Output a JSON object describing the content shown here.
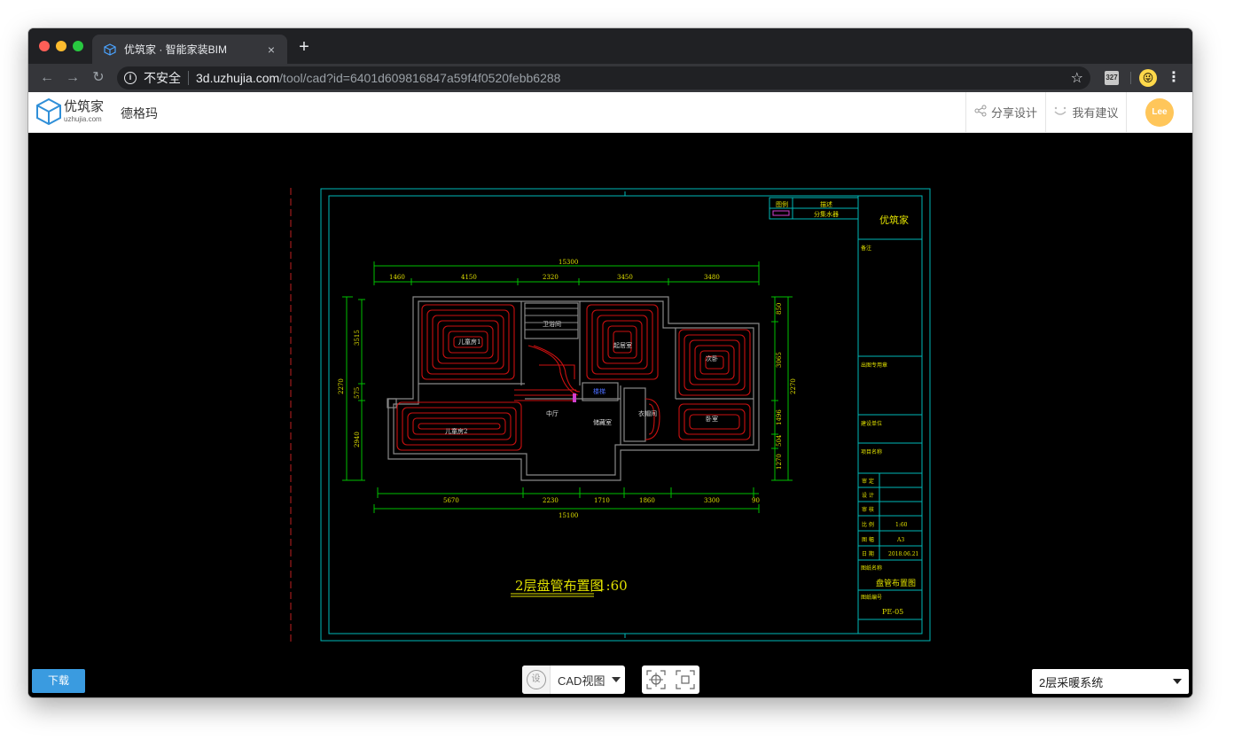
{
  "browser": {
    "tab_title": "优筑家 · 智能家装BIM",
    "tab_close": "×",
    "new_tab": "+",
    "security_label": "不安全",
    "url_host": "3d.uzhujia.com",
    "url_path": "/tool/cad?id=6401d609816847a59f4f0520febb6288",
    "extension_badge": "327"
  },
  "header": {
    "logo_cn": "优筑家",
    "logo_en": "uzhujia.com",
    "project_name": "德格玛",
    "share_label": "分享设计",
    "suggest_label": "我有建议",
    "avatar_text": "Lee"
  },
  "cad": {
    "title": "2层盘管布置图",
    "scale": "1:60",
    "legend_header_1": "图例",
    "legend_header_2": "描述",
    "legend_item_1": "分集水器",
    "company": "优筑家",
    "notes_label": "备注",
    "stamp_label": "出图专用章",
    "unit_label": "建设单位",
    "project_label": "项目名称",
    "rows": [
      {
        "k": "审 定",
        "v": ""
      },
      {
        "k": "设 计",
        "v": ""
      },
      {
        "k": "审 核",
        "v": ""
      },
      {
        "k": "比 例",
        "v": "1:60"
      },
      {
        "k": "图 幅",
        "v": "A3"
      },
      {
        "k": "日 期",
        "v": "2018.06.21"
      }
    ],
    "drawing_name_label": "图纸名称",
    "drawing_name": "盘管布置图",
    "drawing_no_label": "图纸编号",
    "drawing_no": "PE-05",
    "top_total": "15300",
    "top_dims": [
      "1460",
      "4150",
      "2320",
      "3450",
      "3480"
    ],
    "bottom_dims": [
      "5670",
      "2230",
      "1710",
      "1860",
      "3300",
      "90"
    ],
    "bottom_total": "15100",
    "left_dims": [
      "3515",
      "575",
      "2940"
    ],
    "left_total": "2270",
    "right_dims": [
      "850",
      "3065",
      "1496",
      "504",
      "1270"
    ],
    "right_total": "2270",
    "rooms": [
      "儿童房1",
      "卫浴间",
      "起居室",
      "次卧",
      "楼梯",
      "中厅",
      "衣帽间",
      "儿童房2",
      "储藏室",
      "卧室"
    ]
  },
  "controls": {
    "download_label": "下载",
    "view_icon_text": "设",
    "view_mode": "CAD视图",
    "system_select": "2层采暖系统"
  }
}
